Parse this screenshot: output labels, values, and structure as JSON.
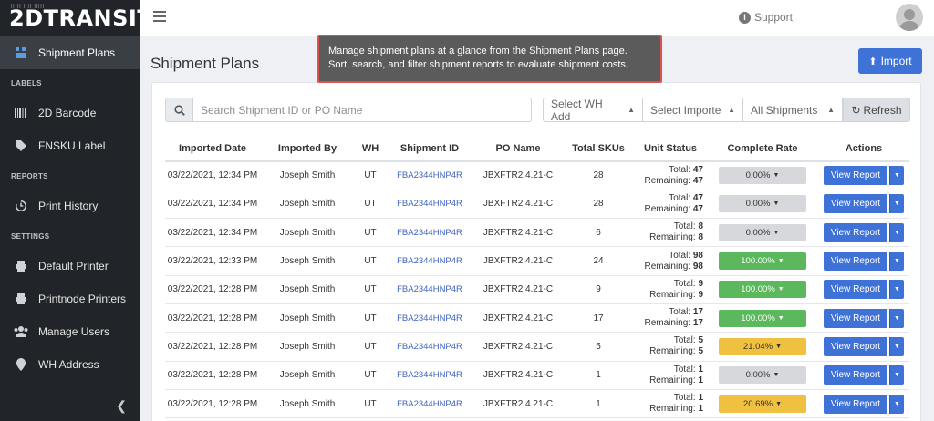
{
  "app": {
    "logo": "2DTRANSIT",
    "logo_sub": "||||| |||| |||||"
  },
  "sidebar": {
    "items": [
      {
        "label": "Shipment Plans",
        "icon": "boxes-icon"
      },
      {
        "section": "LABELS"
      },
      {
        "label": "2D Barcode",
        "icon": "barcode-icon"
      },
      {
        "label": "FNSKU Label",
        "icon": "tag-icon"
      },
      {
        "section": "REPORTS"
      },
      {
        "label": "Print History",
        "icon": "history-icon"
      },
      {
        "section": "SETTINGS"
      },
      {
        "label": "Default Printer",
        "icon": "printer-icon"
      },
      {
        "label": "Printnode Printers",
        "icon": "printer-icon"
      },
      {
        "label": "Manage Users",
        "icon": "users-icon"
      },
      {
        "label": "WH Address",
        "icon": "map-pin-icon"
      }
    ],
    "labels": {
      "shipment_plans": "Shipment Plans",
      "labels_section": "LABELS",
      "barcode": "2D Barcode",
      "fnsku": "FNSKU Label",
      "reports_section": "REPORTS",
      "print_history": "Print History",
      "settings_section": "SETTINGS",
      "default_printer": "Default Printer",
      "printnode": "Printnode Printers",
      "manage_users": "Manage Users",
      "wh_address": "WH Address"
    }
  },
  "topbar": {
    "support_label": "Support"
  },
  "page": {
    "title": "Shipment Plans",
    "import_label": "Import"
  },
  "tooltip": {
    "text": "Manage shipment plans at a glance from the Shipment Plans page. Sort, search, and filter shipment reports to evaluate shipment costs."
  },
  "search": {
    "placeholder": "Search Shipment ID or PO Name"
  },
  "filters": {
    "wh": "Select WH Add",
    "importer": "Select Importe",
    "status": "All Shipments",
    "refresh": "Refresh"
  },
  "table": {
    "headers": [
      "Imported Date",
      "Imported By",
      "WH",
      "Shipment ID",
      "PO Name",
      "Total SKUs",
      "Unit Status",
      "Complete Rate",
      "Actions"
    ],
    "total_label": "Total:",
    "remaining_label": "Remaining:",
    "action_label": "View Report",
    "rows": [
      {
        "date": "03/22/2021, 12:34 PM",
        "by": "Joseph Smith",
        "wh": "UT",
        "shipment": "FBA2344HNP4R",
        "po": "JBXFTR2.4.21-C",
        "skus": "28",
        "total": "47",
        "remaining": "47",
        "rate": "0.00%",
        "rate_color": "grey"
      },
      {
        "date": "03/22/2021, 12:34 PM",
        "by": "Joseph Smith",
        "wh": "UT",
        "shipment": "FBA2344HNP4R",
        "po": "JBXFTR2.4.21-C",
        "skus": "28",
        "total": "47",
        "remaining": "47",
        "rate": "0.00%",
        "rate_color": "grey"
      },
      {
        "date": "03/22/2021, 12:34 PM",
        "by": "Joseph Smith",
        "wh": "UT",
        "shipment": "FBA2344HNP4R",
        "po": "JBXFTR2.4.21-C",
        "skus": "6",
        "total": "8",
        "remaining": "8",
        "rate": "0.00%",
        "rate_color": "grey"
      },
      {
        "date": "03/22/2021, 12:33 PM",
        "by": "Joseph Smith",
        "wh": "UT",
        "shipment": "FBA2344HNP4R",
        "po": "JBXFTR2.4.21-C",
        "skus": "24",
        "total": "98",
        "remaining": "98",
        "rate": "100.00%",
        "rate_color": "green"
      },
      {
        "date": "03/22/2021, 12:28 PM",
        "by": "Joseph Smith",
        "wh": "UT",
        "shipment": "FBA2344HNP4R",
        "po": "JBXFTR2.4.21-C",
        "skus": "9",
        "total": "9",
        "remaining": "9",
        "rate": "100.00%",
        "rate_color": "green"
      },
      {
        "date": "03/22/2021, 12:28 PM",
        "by": "Joseph Smith",
        "wh": "UT",
        "shipment": "FBA2344HNP4R",
        "po": "JBXFTR2.4.21-C",
        "skus": "17",
        "total": "17",
        "remaining": "17",
        "rate": "100.00%",
        "rate_color": "green"
      },
      {
        "date": "03/22/2021, 12:28 PM",
        "by": "Joseph Smith",
        "wh": "UT",
        "shipment": "FBA2344HNP4R",
        "po": "JBXFTR2.4.21-C",
        "skus": "5",
        "total": "5",
        "remaining": "5",
        "rate": "21.04%",
        "rate_color": "yellow"
      },
      {
        "date": "03/22/2021, 12:28 PM",
        "by": "Joseph Smith",
        "wh": "UT",
        "shipment": "FBA2344HNP4R",
        "po": "JBXFTR2.4.21-C",
        "skus": "1",
        "total": "1",
        "remaining": "1",
        "rate": "0.00%",
        "rate_color": "grey"
      },
      {
        "date": "03/22/2021, 12:28 PM",
        "by": "Joseph Smith",
        "wh": "UT",
        "shipment": "FBA2344HNP4R",
        "po": "JBXFTR2.4.21-C",
        "skus": "1",
        "total": "1",
        "remaining": "1",
        "rate": "20.69%",
        "rate_color": "yellow"
      }
    ]
  },
  "colors": {
    "sidebar_bg": "#212529",
    "accent": "#3f72d6",
    "green": "#5cb85c",
    "yellow": "#f0c040",
    "grey": "#d6d8db",
    "tooltip_border": "#d9534f"
  }
}
